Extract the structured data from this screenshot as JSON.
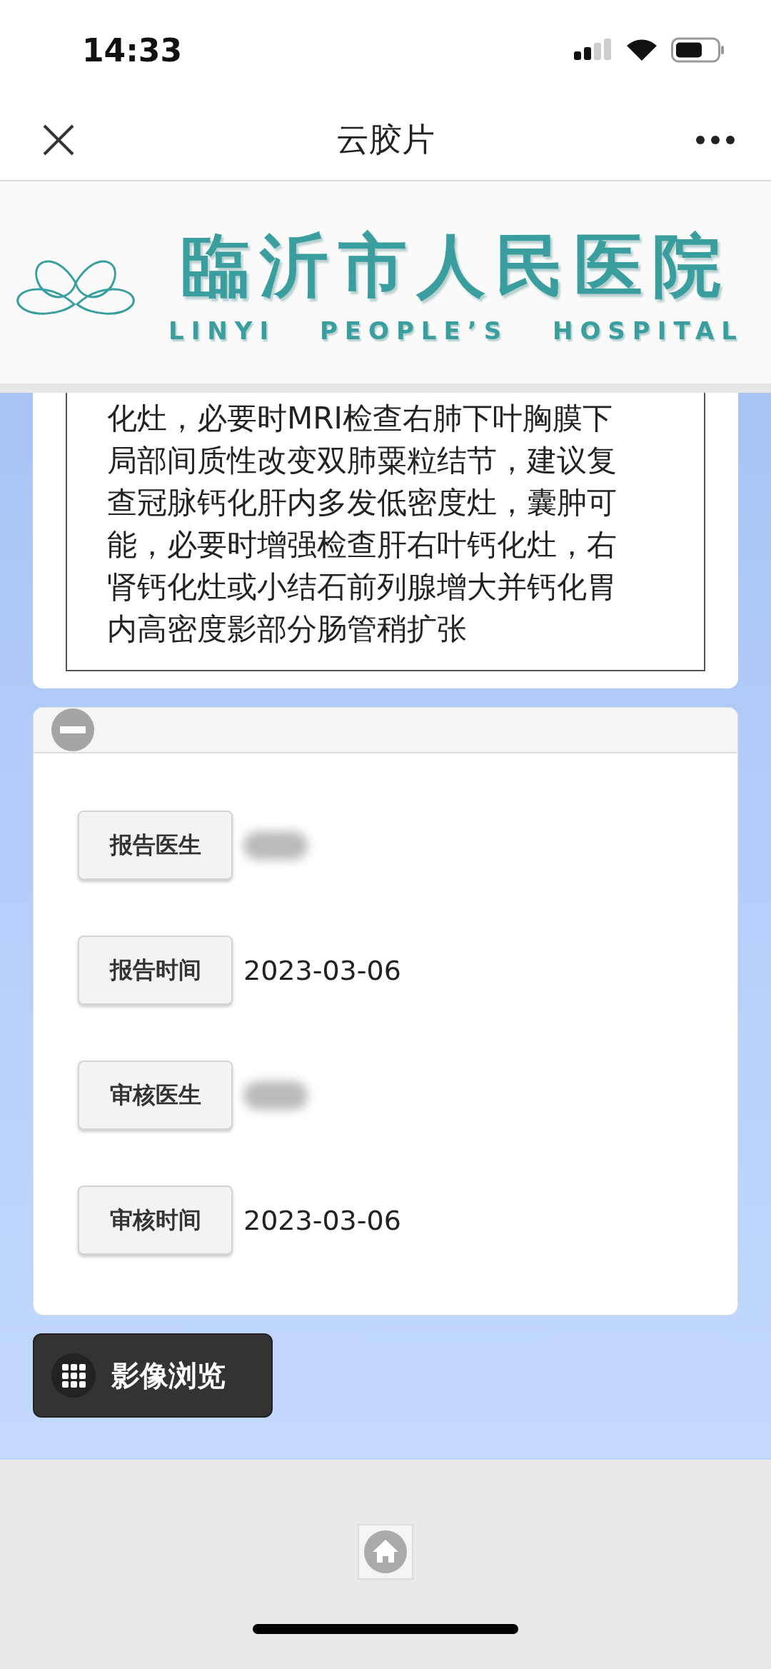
{
  "status_bar": {
    "time": "14:33"
  },
  "nav_bar": {
    "title": "云胶片"
  },
  "banner": {
    "name_zh": "臨沂市人民医院",
    "name_en": "LINYI PEOPLE’S HOSPITAL"
  },
  "report": {
    "text": "化灶，必要时MRI检查右肺下叶胸膜下局部间质性改变双肺粟粒结节，建议复查冠脉钙化肝内多发低密度灶，囊肿可能，必要时增强检查肝右叶钙化灶，右肾钙化灶或小结石前列腺增大并钙化胃内高密度影部分肠管稍扩张"
  },
  "details": {
    "expanded": true,
    "rows": [
      {
        "label": "报告医生",
        "redacted": true
      },
      {
        "label": "报告时间",
        "value": "2023-03-06",
        "redacted": false
      },
      {
        "label": "审核医生",
        "redacted": true
      },
      {
        "label": "审核时间",
        "value": "2023-03-06",
        "redacted": false
      }
    ]
  },
  "image_button": {
    "label": "影像浏览"
  }
}
